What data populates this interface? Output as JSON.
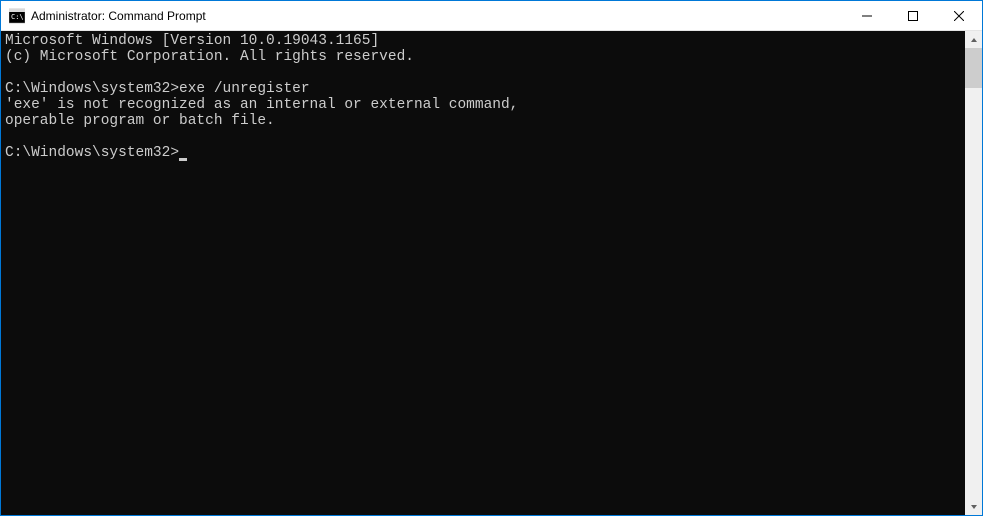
{
  "window": {
    "title": "Administrator: Command Prompt"
  },
  "terminal": {
    "lines": [
      "Microsoft Windows [Version 10.0.19043.1165]",
      "(c) Microsoft Corporation. All rights reserved.",
      "",
      "C:\\Windows\\system32>exe /unregister",
      "'exe' is not recognized as an internal or external command,",
      "operable program or batch file.",
      "",
      "C:\\Windows\\system32>"
    ],
    "cursor_on_last_line": true
  }
}
